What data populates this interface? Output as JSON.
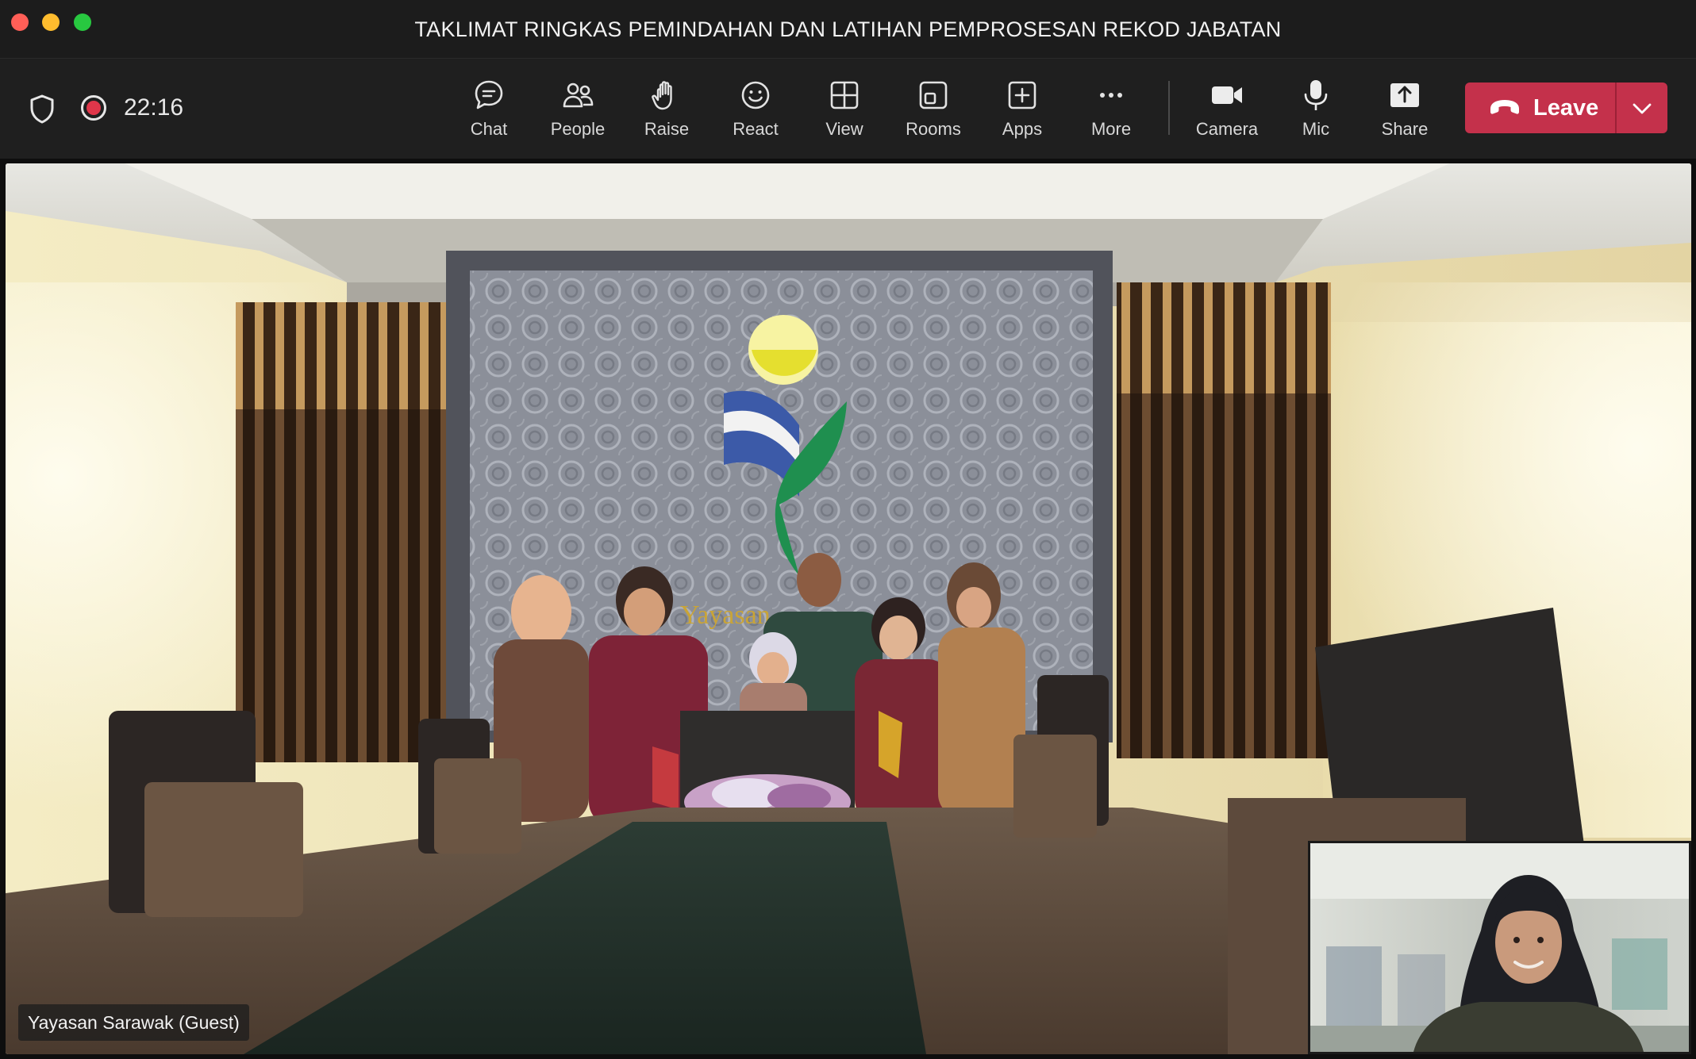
{
  "window": {
    "title": "TAKLIMAT RINGKAS PEMINDAHAN DAN LATIHAN PEMPROSESAN REKOD JABATAN"
  },
  "status": {
    "timer": "22:16"
  },
  "toolbar": {
    "chat": "Chat",
    "people": "People",
    "raise": "Raise",
    "react": "React",
    "view": "View",
    "rooms": "Rooms",
    "apps": "Apps",
    "more": "More",
    "camera": "Camera",
    "mic": "Mic",
    "share": "Share",
    "leave": "Leave"
  },
  "video": {
    "participant_name": "Yayasan Sarawak (Guest)",
    "wall_sign": "Yayasan"
  },
  "colors": {
    "leave_button": "#c4314b",
    "record_dot": "#e0364a",
    "toolbar_bg": "#1f1f1f"
  },
  "icons": [
    "shield-icon",
    "record-icon",
    "chat-icon",
    "people-icon",
    "raise-hand-icon",
    "react-icon",
    "view-icon",
    "rooms-icon",
    "apps-icon",
    "more-icon",
    "camera-icon",
    "mic-icon",
    "share-icon",
    "phone-hangup-icon",
    "chevron-down-icon"
  ]
}
